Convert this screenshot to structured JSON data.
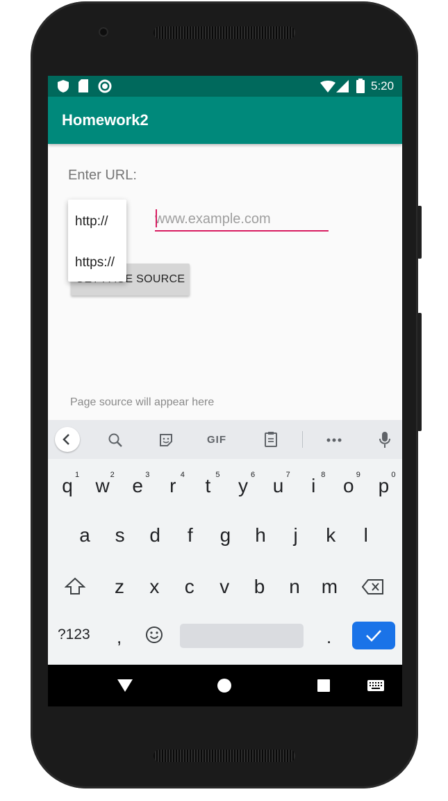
{
  "status_bar": {
    "time": "5:20"
  },
  "app_bar": {
    "title": "Homework2"
  },
  "form": {
    "url_label": "Enter URL:",
    "url_placeholder": "www.example.com",
    "get_button_label": "GET PAGE SOURCE",
    "protocol_options": [
      "http://",
      "https://"
    ],
    "output_text": "Page source will appear here"
  },
  "keyboard": {
    "toolbar": [
      "back-icon",
      "search-icon",
      "sticker-icon",
      "gif-icon",
      "clipboard-icon",
      "more-icon",
      "mic-icon"
    ],
    "gif_label": "GIF",
    "row1": [
      "q",
      "w",
      "e",
      "r",
      "t",
      "y",
      "u",
      "i",
      "o",
      "p"
    ],
    "row1_hints": [
      "1",
      "2",
      "3",
      "4",
      "5",
      "6",
      "7",
      "8",
      "9",
      "0"
    ],
    "row2": [
      "a",
      "s",
      "d",
      "f",
      "g",
      "h",
      "j",
      "k",
      "l"
    ],
    "row3": [
      "z",
      "x",
      "c",
      "v",
      "b",
      "n",
      "m"
    ],
    "symbols_label": "?123",
    "comma": ",",
    "period": "."
  }
}
